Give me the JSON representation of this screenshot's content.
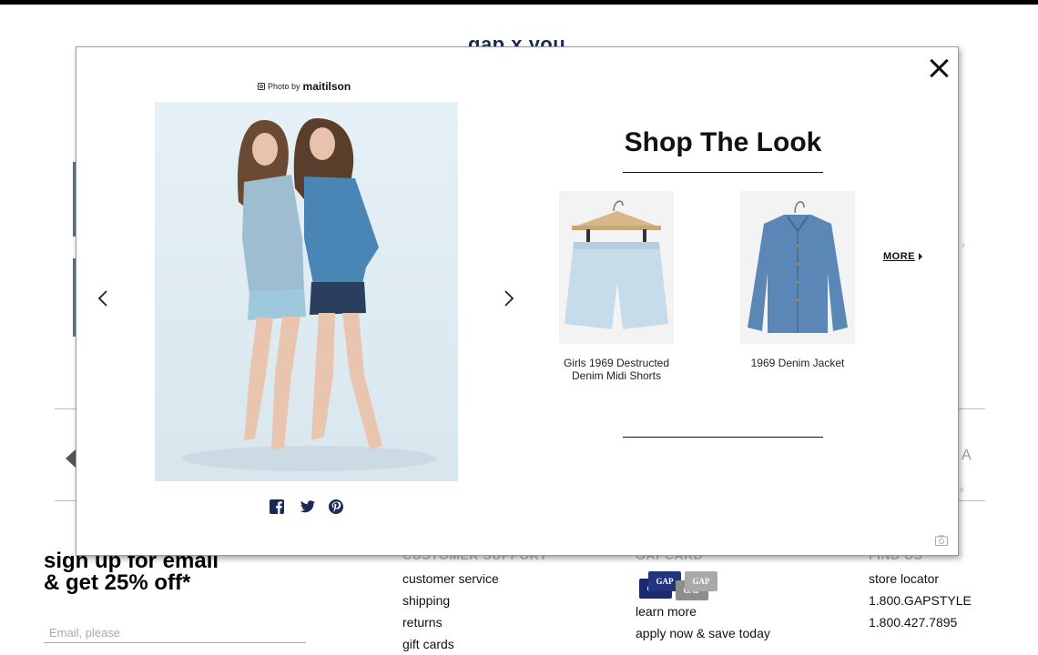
{
  "background": {
    "title": "gap x you",
    "signup": {
      "line1": "sign up for email",
      "line2": "& get 25% off*",
      "email_placeholder": "Email, please"
    },
    "customer_support": {
      "heading": "CUSTOMER SUPPORT",
      "links": [
        "customer service",
        "shipping",
        "returns",
        "gift cards"
      ]
    },
    "gap_card": {
      "heading": "GAPCARD",
      "card_text": "GAP",
      "links": [
        "learn more",
        "apply now & save today"
      ]
    },
    "find_us": {
      "heading": "FIND US",
      "links": [
        "store locator",
        "1.800.GAPSTYLE",
        "1.800.427.7895"
      ]
    },
    "partial_letter": "A",
    "partial_dot": "s"
  },
  "modal": {
    "photo_credit": {
      "prefix": "Photo by",
      "username": "maitilson"
    },
    "shop_title": "Shop The Look",
    "products": [
      {
        "name": "Girls 1969 Destructed Denim Midi Shorts"
      },
      {
        "name": "1969 Denim Jacket"
      }
    ],
    "more_label": "MORE",
    "icons": [
      "close-icon",
      "chevron-left-icon",
      "chevron-right-icon",
      "facebook-icon",
      "twitter-icon",
      "pinterest-icon",
      "camera-icon"
    ],
    "colors": {
      "share_icons": "#1a2a52",
      "text": "#111111"
    }
  }
}
